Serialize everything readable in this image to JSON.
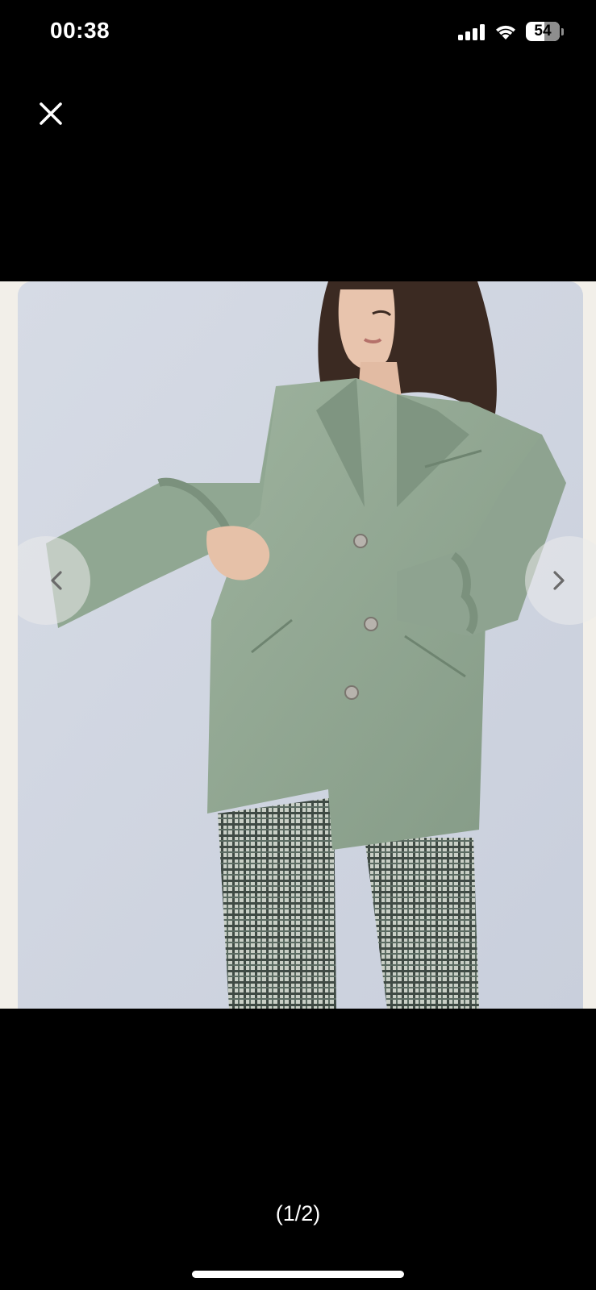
{
  "status_bar": {
    "time": "00:38",
    "battery_level": "54",
    "icons": [
      "signal-icon",
      "wifi-icon",
      "battery-icon"
    ]
  },
  "viewer": {
    "close_icon": "close-icon",
    "prev_icon": "chevron-left-icon",
    "next_icon": "chevron-right-icon",
    "page_counter": "(1/2)",
    "current_image": 1,
    "total_images": 2,
    "image_description_icon": "product-photo"
  },
  "colors": {
    "background": "#000000",
    "image_matte": "#f2efe9",
    "jacket": "#8fa590",
    "backdrop": "#d2d7e2"
  }
}
